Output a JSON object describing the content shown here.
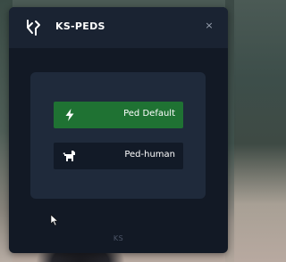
{
  "window": {
    "title": "KS-PEDS",
    "close_glyph": "×",
    "logo_icon": "ks-logo-icon"
  },
  "menu": {
    "items": [
      {
        "label": "Ped Default",
        "icon": "lightning-bolt-icon",
        "selected": true,
        "color": "#1f7233"
      },
      {
        "label": "Ped-human",
        "icon": "dog-icon",
        "selected": false,
        "color": "#121a27"
      }
    ]
  },
  "footer": {
    "text": "KS"
  },
  "colors": {
    "window_bg": "#121925",
    "titlebar_bg": "#1a2332",
    "panel_bg": "#1f2a3b",
    "accent_green": "#1f7233"
  }
}
